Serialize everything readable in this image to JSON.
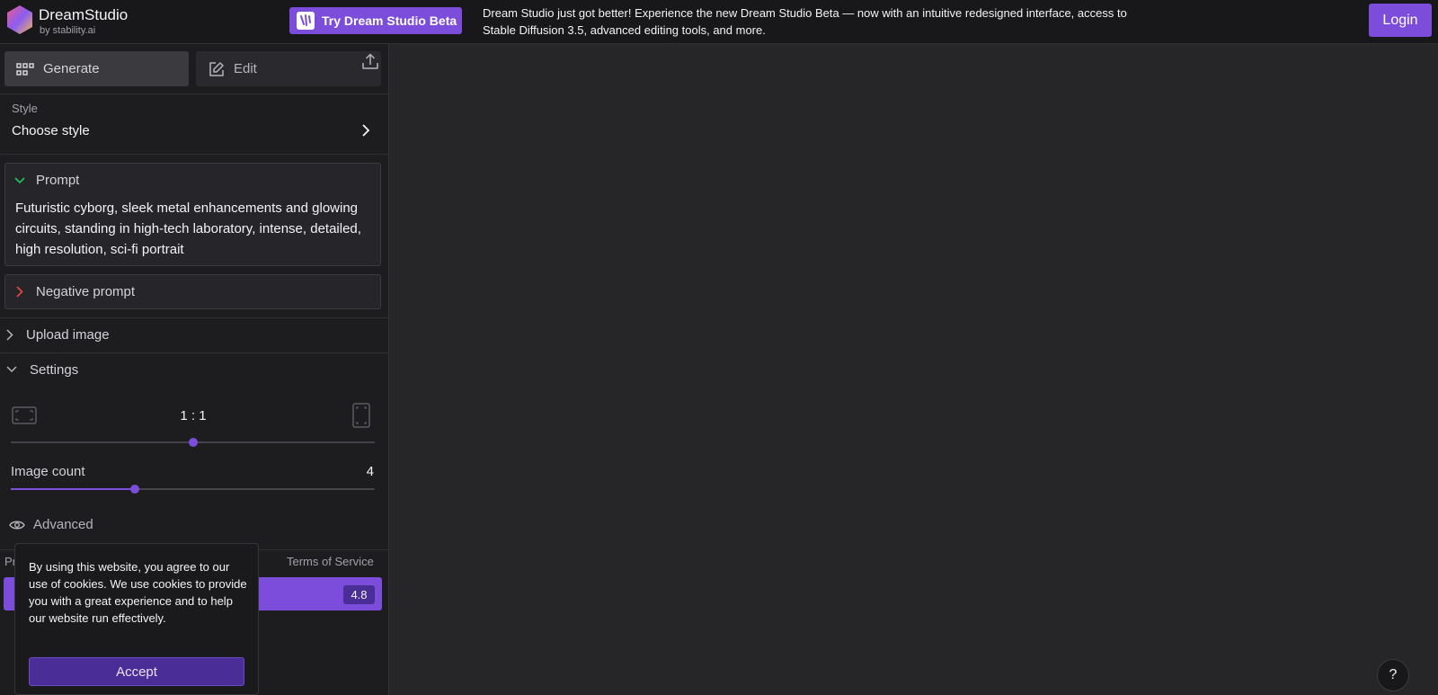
{
  "header": {
    "brand_title": "DreamStudio",
    "brand_sub": "by stability.ai",
    "beta_button": "Try Dream Studio Beta",
    "announcement": "Dream Studio just got better! Experience the new Dream Studio Beta — now with an intuitive redesigned interface, access to Stable Diffusion 3.5, advanced editing tools, and more.",
    "login": "Login"
  },
  "tabs": [
    {
      "label": "Generate",
      "icon": "grid-icon",
      "active": true
    },
    {
      "label": "Edit",
      "icon": "edit-icon",
      "active": false
    }
  ],
  "style": {
    "label": "Style",
    "value": "Choose style"
  },
  "prompt": {
    "label": "Prompt",
    "text": "Futuristic cyborg, sleek metal enhancements and glowing circuits, standing in high-tech laboratory, intense, detailed, high resolution, sci-fi portrait"
  },
  "negative_prompt": {
    "label": "Negative prompt"
  },
  "upload": {
    "label": "Upload image"
  },
  "settings": {
    "label": "Settings",
    "aspect_ratio": {
      "value": "1 : 1",
      "slider_fraction": 0.5
    },
    "image_count": {
      "label": "Image count",
      "value": "4",
      "slider_fraction": 0.34
    }
  },
  "advanced": {
    "label": "Advanced"
  },
  "footer_links": {
    "privacy": "Pr",
    "terms": "Terms of Service"
  },
  "dream": {
    "credits": "4.8"
  },
  "cookie": {
    "text": "By using this website, you agree to our use of cookies. We use cookies to provide you with a great experience and to help our website run effectively.",
    "accept": "Accept"
  },
  "help": {
    "label": "?"
  },
  "colors": {
    "accent": "#7c4ddb",
    "background": "#262629",
    "sidebar": "#1d1d20"
  }
}
